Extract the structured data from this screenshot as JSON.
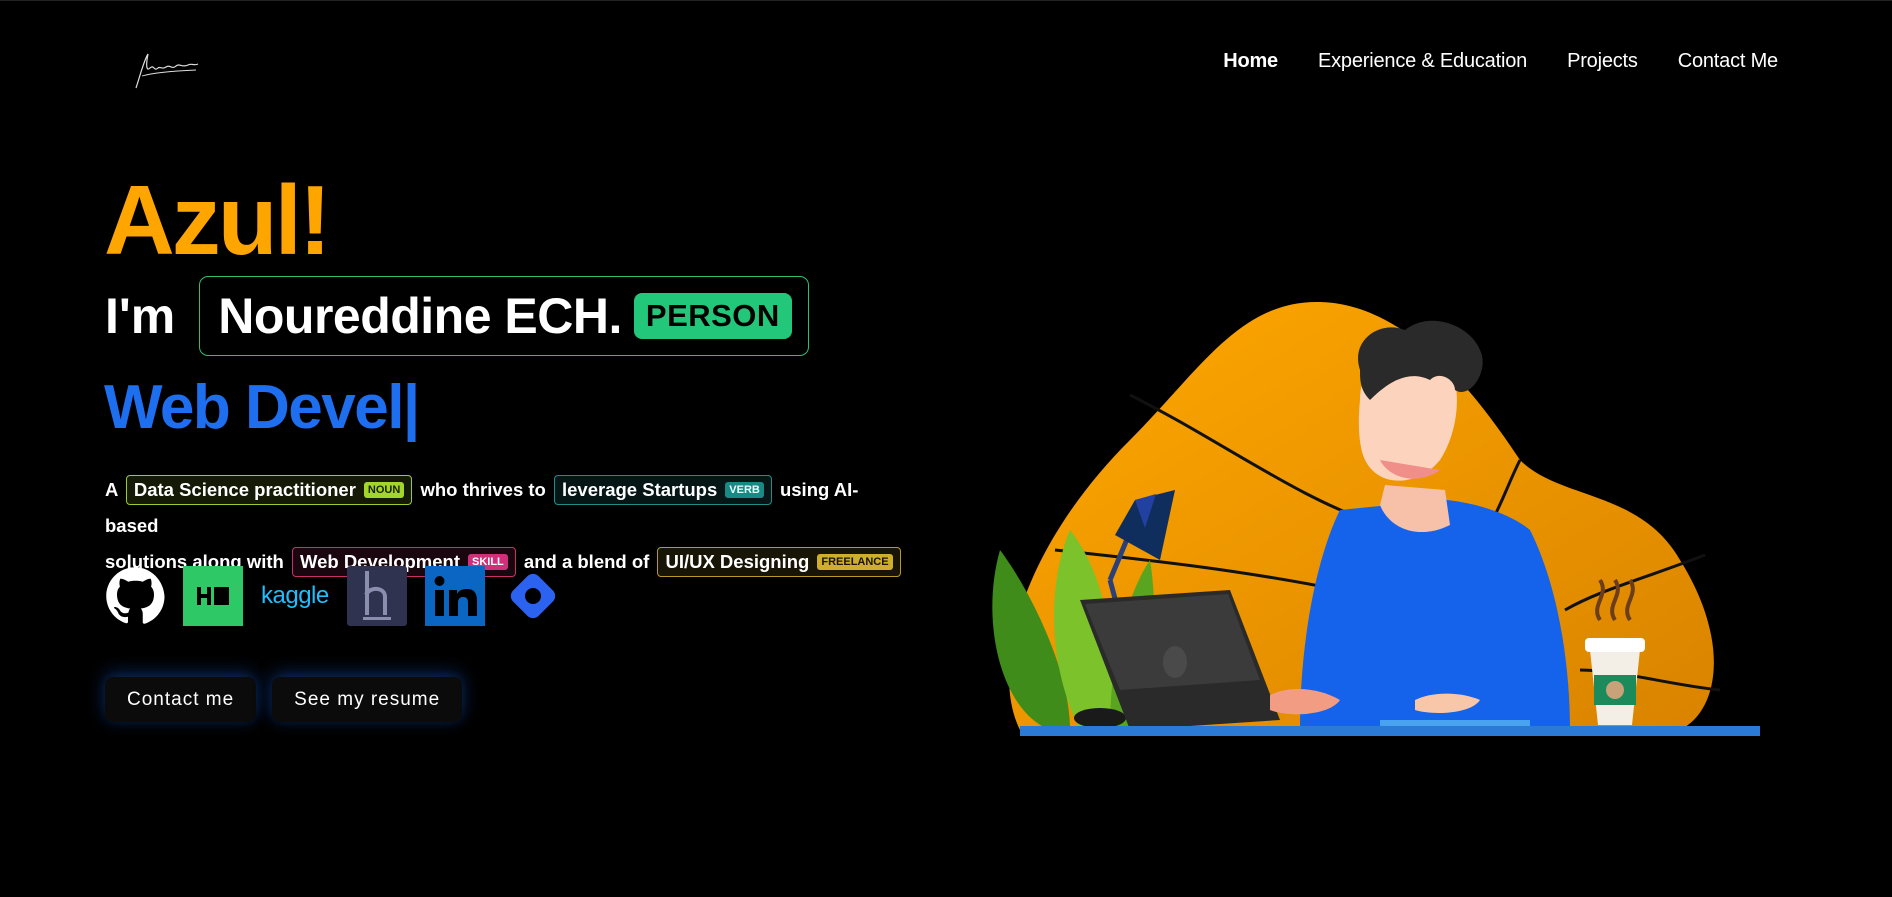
{
  "header": {
    "nav": [
      "Home",
      "Experience & Education",
      "Projects",
      "Contact Me"
    ]
  },
  "hero": {
    "greeting": "Azul!",
    "im": "I'm",
    "name": "Noureddine ECH.",
    "name_tag": "PERSON",
    "typed_text": "Web Devel|",
    "para": {
      "a": "A",
      "noun_text": "Data Science practitioner",
      "noun_tag": "NOUN",
      "thrives": "who thrives to",
      "verb_text": "leverage Startups",
      "verb_tag": "VERB",
      "using": "using AI-based",
      "solutions": "solutions along with",
      "skill_text": "Web Development",
      "skill_tag": "SKILL",
      "blend": "and a blend of",
      "free_text": "UI/UX Designing",
      "free_tag": "FREELANCE"
    },
    "socials": {
      "kaggle": "kaggle"
    },
    "buttons": {
      "contact": "Contact me",
      "resume": "See my resume"
    }
  },
  "colors": {
    "accent_orange": "#FFA500",
    "accent_blue": "#1E6FF0",
    "person_tag": "#22c77a"
  },
  "icons": [
    "signature-logo",
    "github-icon",
    "hackerrank-icon",
    "kaggle-icon",
    "hashnode-icon",
    "linkedin-icon",
    "polywork-icon"
  ]
}
